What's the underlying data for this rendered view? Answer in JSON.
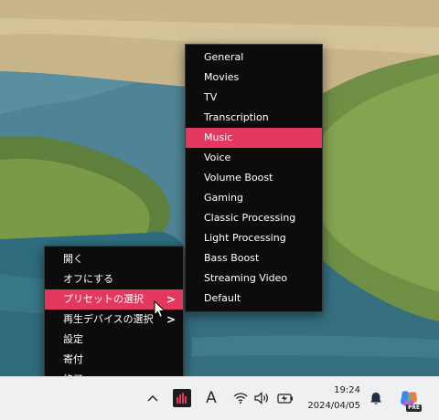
{
  "context_menu": {
    "items": [
      {
        "label": "開く"
      },
      {
        "label": "オフにする"
      },
      {
        "label": "プリセットの選択",
        "has_submenu": true,
        "highlighted": true
      },
      {
        "label": "再生デバイスの選択",
        "has_submenu": true
      },
      {
        "label": "設定"
      },
      {
        "label": "寄付"
      },
      {
        "label": "終了"
      }
    ],
    "chevron": ">"
  },
  "preset_submenu": {
    "items": [
      {
        "label": "General"
      },
      {
        "label": "Movies"
      },
      {
        "label": "TV"
      },
      {
        "label": "Transcription"
      },
      {
        "label": "Music",
        "highlighted": true
      },
      {
        "label": "Voice"
      },
      {
        "label": "Volume Boost"
      },
      {
        "label": "Gaming"
      },
      {
        "label": "Classic Processing"
      },
      {
        "label": "Light Processing"
      },
      {
        "label": "Bass Boost"
      },
      {
        "label": "Streaming Video"
      },
      {
        "label": "Default"
      }
    ]
  },
  "taskbar": {
    "time": "19:24",
    "date": "2024/04/05",
    "ime_indicator": "A",
    "copilot_badge": "PRE",
    "icons": [
      "chevron-up-icon",
      "audio-app-icon",
      "ime-icon",
      "wifi-icon",
      "speaker-icon",
      "battery-icon",
      "notification-bell-icon",
      "copilot-icon"
    ]
  },
  "colors": {
    "highlight": "#e2375f",
    "menu_bg": "#0c0c0c",
    "taskbar_bg": "#eef0f2"
  }
}
